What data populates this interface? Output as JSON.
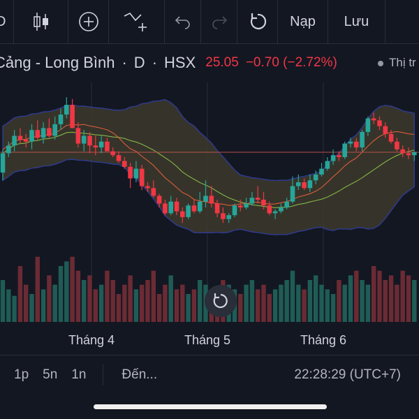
{
  "toolbar": {
    "partial_left": "D",
    "load_label": "Nạp",
    "save_label": "Lưu"
  },
  "symbol": {
    "name": "Cảng - Long Bình",
    "interval": "D",
    "exchange": "HSX",
    "price": "25.05",
    "change": "−0.70 (−2.72%)",
    "market_status": "Thị tr",
    "sep": "·"
  },
  "colors": {
    "background": "#131722",
    "up": "#26a69a",
    "down": "#f23645",
    "band_fill": "#3a3a2a",
    "band_line": "#2f3a8c",
    "ma_line": "#ff6d4d",
    "mid_line": "#8bc34a"
  },
  "time_axis": {
    "labels": [
      "Tháng 4",
      "Tháng 5",
      "Tháng 6"
    ]
  },
  "bottom_bar": {
    "ranges": [
      "1p",
      "5n",
      "1n"
    ],
    "goto_label": "Đến...",
    "clock": "22:28:29 (UTC+7)"
  },
  "icons": [
    "candles-icon",
    "add-indicator-icon",
    "drawing-tool-icon",
    "undo-icon",
    "redo-icon",
    "reload-icon",
    "reset-chart-icon"
  ],
  "chart_data": {
    "type": "candlestick",
    "x": [
      "c01",
      "c02",
      "c03",
      "c04",
      "c05",
      "c06",
      "c07",
      "c08",
      "c09",
      "c10",
      "c11",
      "c12",
      "c13",
      "c14",
      "c15",
      "c16",
      "c17",
      "c18",
      "c19",
      "c20",
      "c21",
      "c22",
      "c23",
      "c24",
      "c25",
      "c26",
      "c27",
      "c28",
      "c29",
      "c30",
      "c31",
      "c32",
      "c33",
      "c34",
      "c35",
      "c36",
      "c37",
      "c38",
      "c39",
      "c40",
      "c41",
      "c42",
      "c43",
      "c44",
      "c45",
      "c46",
      "c47",
      "c48",
      "c49",
      "c50",
      "c51",
      "c52",
      "c53",
      "c54",
      "c55",
      "c56",
      "c57",
      "c58",
      "c59",
      "c60",
      "c61",
      "c62",
      "c63",
      "c64",
      "c65",
      "c66",
      "c67",
      "c68",
      "c69",
      "c70",
      "c71",
      "c72"
    ],
    "open": [
      24.0,
      25.0,
      25.4,
      25.9,
      25.7,
      25.6,
      26.2,
      25.8,
      26.3,
      25.9,
      26.5,
      27.0,
      27.5,
      26.3,
      25.5,
      25.9,
      25.4,
      25.3,
      25.6,
      25.1,
      24.9,
      24.6,
      24.3,
      23.7,
      24.2,
      23.3,
      23.2,
      22.8,
      22.4,
      21.9,
      22.5,
      22.0,
      21.7,
      22.3,
      22.0,
      22.5,
      22.8,
      22.4,
      21.9,
      21.6,
      21.8,
      22.3,
      22.2,
      22.4,
      22.7,
      22.6,
      22.3,
      21.9,
      22.0,
      22.2,
      22.5,
      23.3,
      23.5,
      23.2,
      23.6,
      23.9,
      24.2,
      24.6,
      24.9,
      24.8,
      25.5,
      25.6,
      25.3,
      26.1,
      26.8,
      26.7,
      26.4,
      26.0,
      25.6,
      25.2,
      25.0,
      24.9
    ],
    "high": [
      25.2,
      25.6,
      26.2,
      26.3,
      26.0,
      26.5,
      26.7,
      26.6,
      26.8,
      26.9,
      27.3,
      27.9,
      27.8,
      26.6,
      26.2,
      26.1,
      25.9,
      25.9,
      25.8,
      25.3,
      25.1,
      24.8,
      24.5,
      24.6,
      24.4,
      23.5,
      23.6,
      22.9,
      22.6,
      22.8,
      22.7,
      22.2,
      22.4,
      22.6,
      23.0,
      23.6,
      23.3,
      22.6,
      22.2,
      21.9,
      22.4,
      22.6,
      22.7,
      23.0,
      23.3,
      23.0,
      22.5,
      22.1,
      22.4,
      22.7,
      23.8,
      23.9,
      23.7,
      23.9,
      24.1,
      24.5,
      24.8,
      25.2,
      25.1,
      25.6,
      25.8,
      25.8,
      26.2,
      26.9,
      27.1,
      26.9,
      26.6,
      26.2,
      25.8,
      25.4,
      25.3,
      25.1
    ],
    "low": [
      23.6,
      24.8,
      25.1,
      25.5,
      25.3,
      25.2,
      25.7,
      25.5,
      25.8,
      25.7,
      26.2,
      26.8,
      26.4,
      25.3,
      25.1,
      25.0,
      24.9,
      25.0,
      25.1,
      24.8,
      24.5,
      24.2,
      23.2,
      23.5,
      23.1,
      23.0,
      22.7,
      22.2,
      21.8,
      21.8,
      21.8,
      21.4,
      21.6,
      21.9,
      21.9,
      22.2,
      22.2,
      21.7,
      21.4,
      21.4,
      21.7,
      22.0,
      22.1,
      22.3,
      22.4,
      22.1,
      21.8,
      21.6,
      21.9,
      22.1,
      22.4,
      23.1,
      23.1,
      23.0,
      23.4,
      23.8,
      24.1,
      24.4,
      24.6,
      24.7,
      25.3,
      25.1,
      25.1,
      25.9,
      26.5,
      26.2,
      25.8,
      25.5,
      25.1,
      24.8,
      24.7,
      24.6
    ],
    "close": [
      25.0,
      25.4,
      25.9,
      25.7,
      25.6,
      26.2,
      25.8,
      26.3,
      25.9,
      26.5,
      27.0,
      27.5,
      26.3,
      25.5,
      25.9,
      25.4,
      25.3,
      25.6,
      25.1,
      24.9,
      24.6,
      24.3,
      23.7,
      24.2,
      23.3,
      23.2,
      22.8,
      22.4,
      21.9,
      22.5,
      22.0,
      21.7,
      22.3,
      22.0,
      22.5,
      22.8,
      22.4,
      21.9,
      21.6,
      21.8,
      22.3,
      22.2,
      22.4,
      22.7,
      22.6,
      22.3,
      21.9,
      22.0,
      22.2,
      22.5,
      23.3,
      23.5,
      23.2,
      23.6,
      23.9,
      24.2,
      24.6,
      24.9,
      24.8,
      25.5,
      25.6,
      25.3,
      26.1,
      26.8,
      26.7,
      26.4,
      26.0,
      25.6,
      25.2,
      25.0,
      24.9,
      25.05
    ],
    "volume": [
      45,
      35,
      28,
      60,
      40,
      30,
      70,
      35,
      50,
      40,
      60,
      65,
      70,
      55,
      45,
      50,
      35,
      40,
      55,
      45,
      30,
      40,
      50,
      35,
      40,
      45,
      55,
      30,
      40,
      50,
      35,
      40,
      30,
      35,
      45,
      40,
      30,
      35,
      45,
      40,
      35,
      30,
      40,
      45,
      35,
      40,
      30,
      35,
      40,
      45,
      55,
      40,
      35,
      45,
      50,
      40,
      35,
      30,
      45,
      40,
      50,
      55,
      45,
      40,
      60,
      55,
      45,
      50,
      40,
      55,
      50,
      45
    ]
  }
}
